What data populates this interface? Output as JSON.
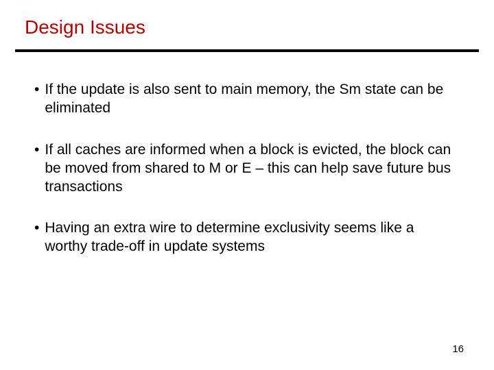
{
  "title": "Design Issues",
  "bullets": [
    "If the update is also sent to main memory, the Sm state can be eliminated",
    "If all caches are informed when a block is evicted, the block can be moved from shared to M or E – this can help save future bus transactions",
    "Having an extra wire to determine exclusivity seems like a worthy trade-off in update systems"
  ],
  "page_number": "16"
}
